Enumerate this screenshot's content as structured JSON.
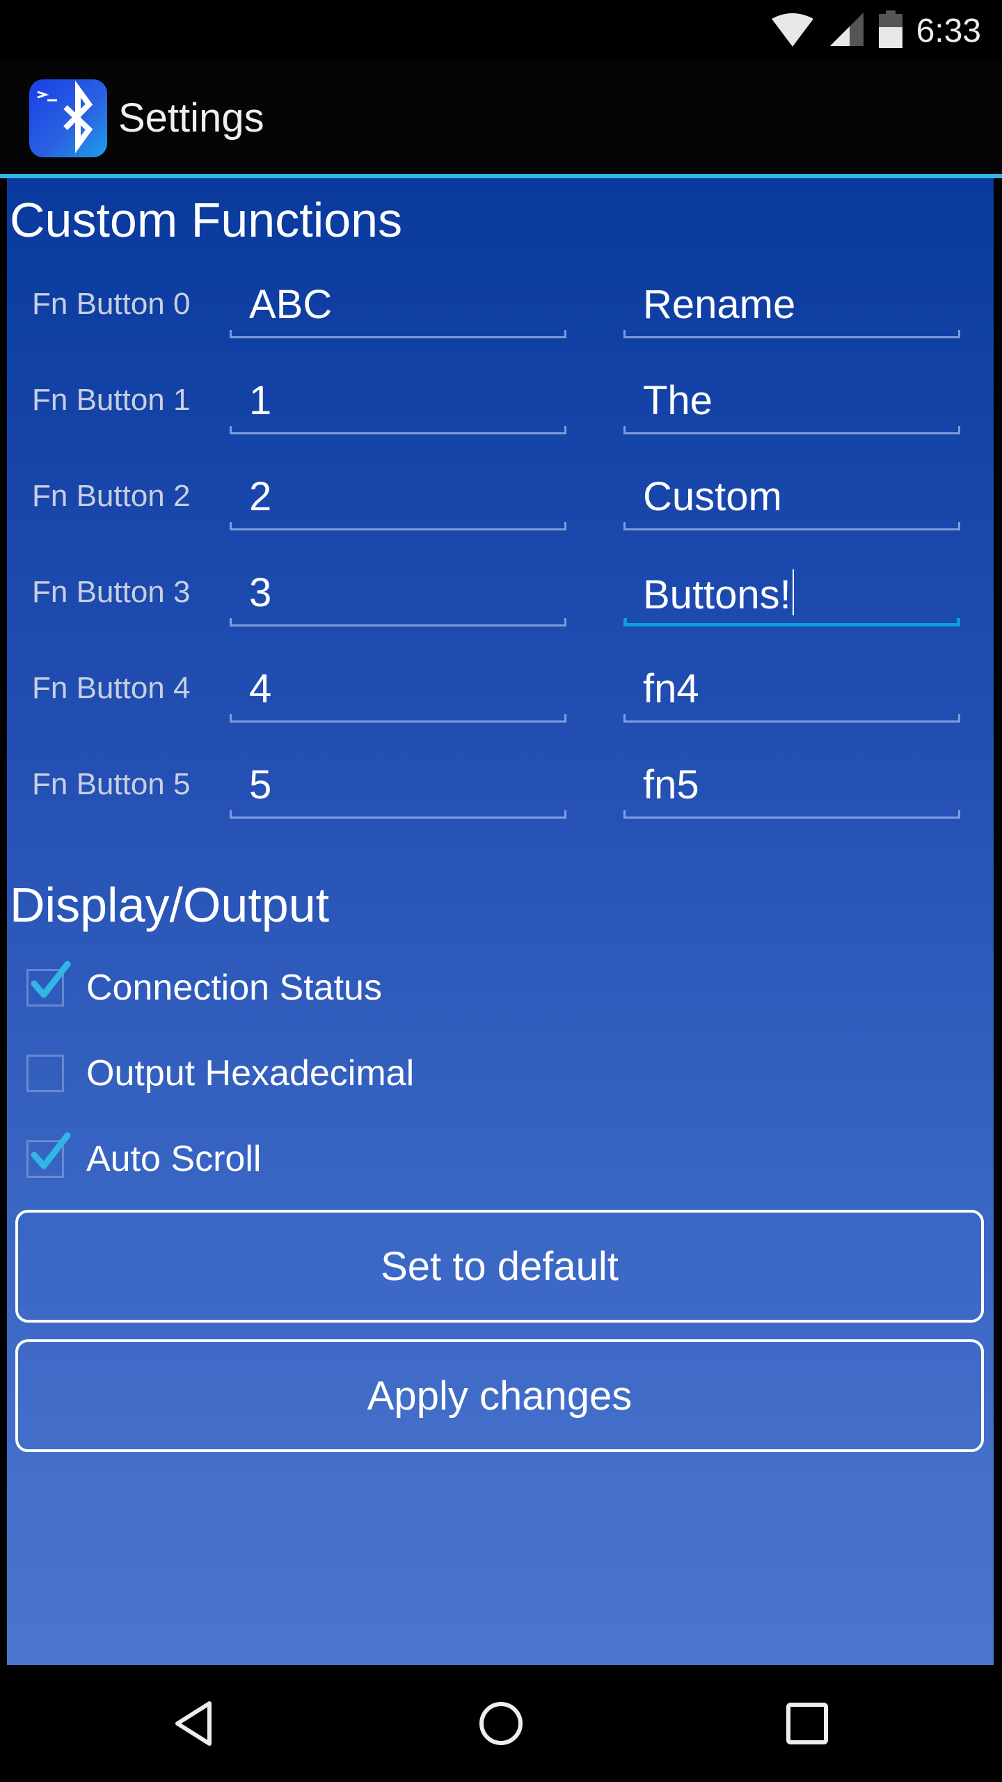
{
  "status_bar": {
    "time": "6:33",
    "icons": [
      "wifi-icon",
      "cell-signal-icon",
      "battery-icon"
    ]
  },
  "app_bar": {
    "icon": "bluetooth-terminal-icon",
    "title": "Settings"
  },
  "custom_functions": {
    "title": "Custom Functions",
    "rows": [
      {
        "label": "Fn Button 0",
        "command": "ABC",
        "name": "Rename"
      },
      {
        "label": "Fn Button 1",
        "command": "1",
        "name": "The"
      },
      {
        "label": "Fn Button 2",
        "command": "2",
        "name": "Custom"
      },
      {
        "label": "Fn Button 3",
        "command": "3",
        "name": "Buttons!"
      },
      {
        "label": "Fn Button 4",
        "command": "4",
        "name": "fn4"
      },
      {
        "label": "Fn Button 5",
        "command": "5",
        "name": "fn5"
      }
    ],
    "focused_field": "Fn Button 3 name"
  },
  "display_output": {
    "title": "Display/Output",
    "options": [
      {
        "label": "Connection Status",
        "checked": true
      },
      {
        "label": "Output Hexadecimal",
        "checked": false
      },
      {
        "label": "Auto Scroll",
        "checked": true
      }
    ]
  },
  "buttons": {
    "set_default": "Set to default",
    "apply": "Apply changes"
  },
  "nav_bar": {
    "icons": [
      "back-icon",
      "home-icon",
      "recents-icon"
    ]
  },
  "colors": {
    "accent": "#33b5e5",
    "focus_underline": "#0aa0dc",
    "check": "#33b5e5"
  }
}
